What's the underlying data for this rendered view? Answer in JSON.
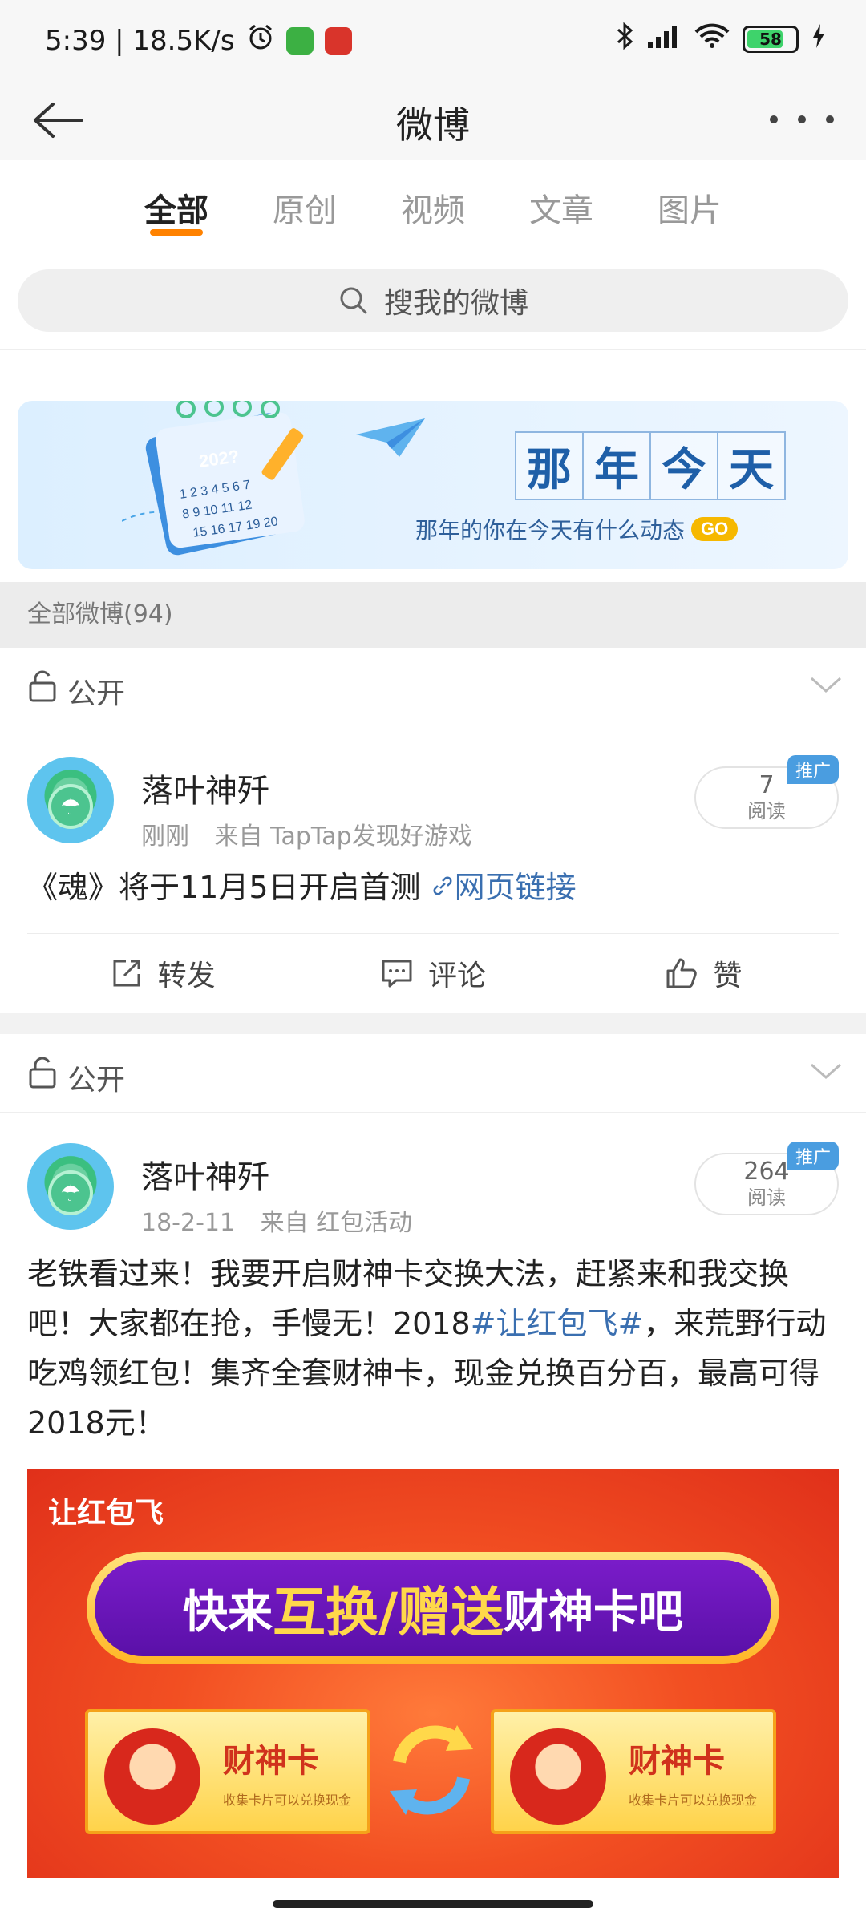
{
  "status_bar": {
    "time_speed": "5:39 | 18.5K/s",
    "battery": "58",
    "colors": {
      "app1": "#3cb043",
      "app2": "#d9342b"
    }
  },
  "header": {
    "title": "微博"
  },
  "tabs": [
    {
      "label": "全部",
      "active": true
    },
    {
      "label": "原创",
      "active": false
    },
    {
      "label": "视频",
      "active": false
    },
    {
      "label": "文章",
      "active": false
    },
    {
      "label": "图片",
      "active": false
    }
  ],
  "search": {
    "placeholder": "搜我的微博"
  },
  "banner": {
    "calendar_year": "202?",
    "title_chars": [
      "那",
      "年",
      "今",
      "天"
    ],
    "subtitle": "那年的你在今天有什么动态",
    "go": "GO"
  },
  "count_label": "全部微博(94)",
  "posts": [
    {
      "visibility": "公开",
      "author": "落叶神歼",
      "time": "刚刚",
      "source": "来自 TapTap发现好游戏",
      "reads": "7",
      "reads_label": "阅读",
      "promo": "推广",
      "text": "《魂》将于11月5日开启首测",
      "link_text": "网页链接",
      "actions": {
        "repost": "转发",
        "comment": "评论",
        "like": "赞"
      }
    },
    {
      "visibility": "公开",
      "author": "落叶神歼",
      "time": "18-2-11",
      "source": "来自 红包活动",
      "reads": "264",
      "reads_label": "阅读",
      "promo": "推广",
      "text_before": "老铁看过来！我要开启财神卡交换大法，赶紧来和我交换吧！大家都在抢，手慢无！2018",
      "hashtag": "#让红包飞#",
      "text_after": "，来荒野行动吃鸡领红包！集齐全套财神卡，现金兑换百分百，最高可得2018元！",
      "image": {
        "tag": "让红包飞",
        "headline_a": "快来",
        "headline_b": "互换/赠送",
        "headline_c": "财神卡吧",
        "card_title": "财神卡",
        "card_sub": "收集卡片可以兑换现金"
      }
    }
  ]
}
